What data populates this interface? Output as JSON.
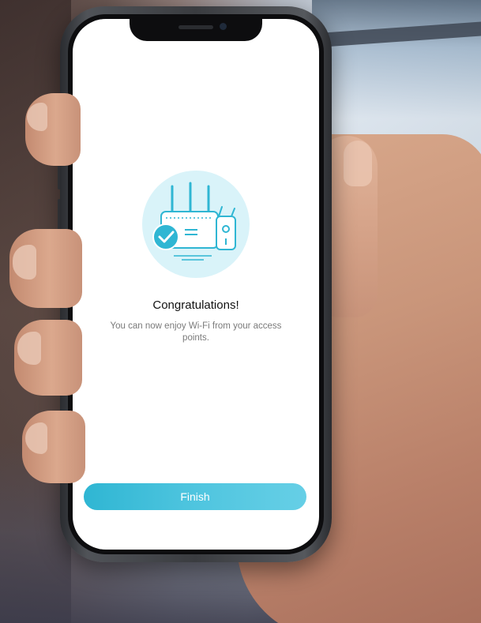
{
  "screen": {
    "title": "Congratulations!",
    "message": "You can now enjoy Wi-Fi from your access points.",
    "finish_button": "Finish"
  },
  "colors": {
    "accent": "#2fb6d3",
    "illustration_bg": "#d9f3f9",
    "title_text": "#111111",
    "message_text": "#7a7a7a"
  },
  "icons": {
    "illustration": "router-extender-illustration",
    "check": "check-circle-icon"
  }
}
